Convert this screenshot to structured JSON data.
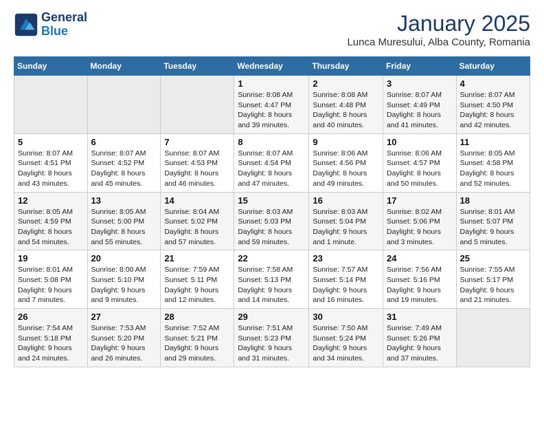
{
  "header": {
    "logo_line1": "General",
    "logo_line2": "Blue",
    "month": "January 2025",
    "location": "Lunca Muresului, Alba County, Romania"
  },
  "weekdays": [
    "Sunday",
    "Monday",
    "Tuesday",
    "Wednesday",
    "Thursday",
    "Friday",
    "Saturday"
  ],
  "weeks": [
    [
      {
        "day": "",
        "info": ""
      },
      {
        "day": "",
        "info": ""
      },
      {
        "day": "",
        "info": ""
      },
      {
        "day": "1",
        "info": "Sunrise: 8:08 AM\nSunset: 4:47 PM\nDaylight: 8 hours\nand 39 minutes."
      },
      {
        "day": "2",
        "info": "Sunrise: 8:08 AM\nSunset: 4:48 PM\nDaylight: 8 hours\nand 40 minutes."
      },
      {
        "day": "3",
        "info": "Sunrise: 8:07 AM\nSunset: 4:49 PM\nDaylight: 8 hours\nand 41 minutes."
      },
      {
        "day": "4",
        "info": "Sunrise: 8:07 AM\nSunset: 4:50 PM\nDaylight: 8 hours\nand 42 minutes."
      }
    ],
    [
      {
        "day": "5",
        "info": "Sunrise: 8:07 AM\nSunset: 4:51 PM\nDaylight: 8 hours\nand 43 minutes."
      },
      {
        "day": "6",
        "info": "Sunrise: 8:07 AM\nSunset: 4:52 PM\nDaylight: 8 hours\nand 45 minutes."
      },
      {
        "day": "7",
        "info": "Sunrise: 8:07 AM\nSunset: 4:53 PM\nDaylight: 8 hours\nand 46 minutes."
      },
      {
        "day": "8",
        "info": "Sunrise: 8:07 AM\nSunset: 4:54 PM\nDaylight: 8 hours\nand 47 minutes."
      },
      {
        "day": "9",
        "info": "Sunrise: 8:06 AM\nSunset: 4:56 PM\nDaylight: 8 hours\nand 49 minutes."
      },
      {
        "day": "10",
        "info": "Sunrise: 8:06 AM\nSunset: 4:57 PM\nDaylight: 8 hours\nand 50 minutes."
      },
      {
        "day": "11",
        "info": "Sunrise: 8:05 AM\nSunset: 4:58 PM\nDaylight: 8 hours\nand 52 minutes."
      }
    ],
    [
      {
        "day": "12",
        "info": "Sunrise: 8:05 AM\nSunset: 4:59 PM\nDaylight: 8 hours\nand 54 minutes."
      },
      {
        "day": "13",
        "info": "Sunrise: 8:05 AM\nSunset: 5:00 PM\nDaylight: 8 hours\nand 55 minutes."
      },
      {
        "day": "14",
        "info": "Sunrise: 8:04 AM\nSunset: 5:02 PM\nDaylight: 8 hours\nand 57 minutes."
      },
      {
        "day": "15",
        "info": "Sunrise: 8:03 AM\nSunset: 5:03 PM\nDaylight: 8 hours\nand 59 minutes."
      },
      {
        "day": "16",
        "info": "Sunrise: 8:03 AM\nSunset: 5:04 PM\nDaylight: 9 hours\nand 1 minute."
      },
      {
        "day": "17",
        "info": "Sunrise: 8:02 AM\nSunset: 5:06 PM\nDaylight: 9 hours\nand 3 minutes."
      },
      {
        "day": "18",
        "info": "Sunrise: 8:01 AM\nSunset: 5:07 PM\nDaylight: 9 hours\nand 5 minutes."
      }
    ],
    [
      {
        "day": "19",
        "info": "Sunrise: 8:01 AM\nSunset: 5:08 PM\nDaylight: 9 hours\nand 7 minutes."
      },
      {
        "day": "20",
        "info": "Sunrise: 8:00 AM\nSunset: 5:10 PM\nDaylight: 9 hours\nand 9 minutes."
      },
      {
        "day": "21",
        "info": "Sunrise: 7:59 AM\nSunset: 5:11 PM\nDaylight: 9 hours\nand 12 minutes."
      },
      {
        "day": "22",
        "info": "Sunrise: 7:58 AM\nSunset: 5:13 PM\nDaylight: 9 hours\nand 14 minutes."
      },
      {
        "day": "23",
        "info": "Sunrise: 7:57 AM\nSunset: 5:14 PM\nDaylight: 9 hours\nand 16 minutes."
      },
      {
        "day": "24",
        "info": "Sunrise: 7:56 AM\nSunset: 5:16 PM\nDaylight: 9 hours\nand 19 minutes."
      },
      {
        "day": "25",
        "info": "Sunrise: 7:55 AM\nSunset: 5:17 PM\nDaylight: 9 hours\nand 21 minutes."
      }
    ],
    [
      {
        "day": "26",
        "info": "Sunrise: 7:54 AM\nSunset: 5:18 PM\nDaylight: 9 hours\nand 24 minutes."
      },
      {
        "day": "27",
        "info": "Sunrise: 7:53 AM\nSunset: 5:20 PM\nDaylight: 9 hours\nand 26 minutes."
      },
      {
        "day": "28",
        "info": "Sunrise: 7:52 AM\nSunset: 5:21 PM\nDaylight: 9 hours\nand 29 minutes."
      },
      {
        "day": "29",
        "info": "Sunrise: 7:51 AM\nSunset: 5:23 PM\nDaylight: 9 hours\nand 31 minutes."
      },
      {
        "day": "30",
        "info": "Sunrise: 7:50 AM\nSunset: 5:24 PM\nDaylight: 9 hours\nand 34 minutes."
      },
      {
        "day": "31",
        "info": "Sunrise: 7:49 AM\nSunset: 5:26 PM\nDaylight: 9 hours\nand 37 minutes."
      },
      {
        "day": "",
        "info": ""
      }
    ]
  ]
}
